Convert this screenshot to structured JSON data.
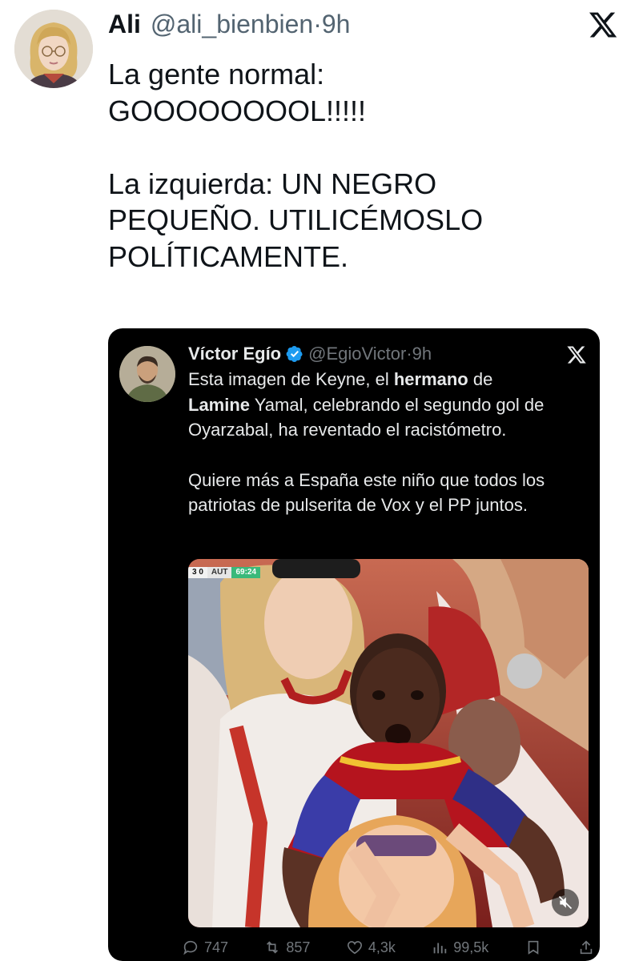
{
  "tweet": {
    "name": "Ali",
    "handle": "@ali_bienbien",
    "separator": "·",
    "time": "9h",
    "text": "La gente normal:\nGOOOOOOOOL!!!!!\n\nLa izquierda: UN NEGRO\nPEQUEÑO. UTILICÉMOSLO\nPOLÍTICAMENTE."
  },
  "quote": {
    "name": "Víctor Egío",
    "handle": "@EgioVictor",
    "separator": "·",
    "time": "9h",
    "line1_a": "Esta imagen de Keyne, el ",
    "line1_b": "hermano",
    "line1_c": " de",
    "line2_a": "Lamine",
    "line2_b": " Yamal, celebrando el segundo gol de Oyarzabal, ha reventado el racistómetro.",
    "paragraph2": "Quiere más a España este niño que todos los patriotas de pulserita de Vox y el PP juntos.",
    "scoreboard": {
      "score": "3 0",
      "team": "AUT",
      "clock": "69:24"
    },
    "actions": {
      "replies": "747",
      "reposts": "857",
      "likes": "4,3k",
      "views": "99,5k"
    }
  },
  "colors": {
    "text": "#0f1419",
    "secondary": "#536471",
    "quote_bg": "#000000",
    "quote_text": "#e7e9ea",
    "quote_secondary": "#71767b",
    "verified": "#1d9bf0"
  }
}
